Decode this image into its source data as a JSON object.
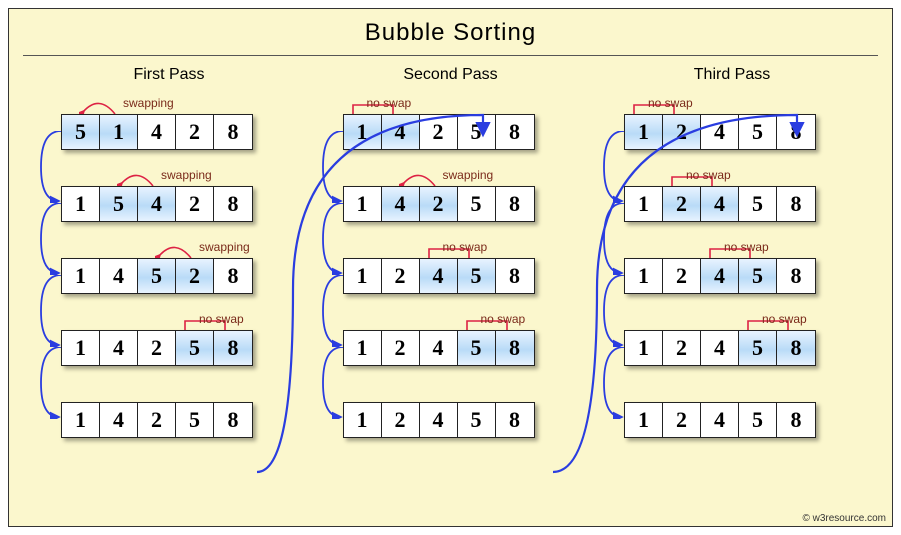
{
  "title": "Bubble  Sorting",
  "copyright": "© w3resource.com",
  "labels": {
    "swap": "swapping",
    "noswap": "no swap"
  },
  "passes": [
    {
      "name": "First  Pass",
      "steps": [
        {
          "cells": [
            5,
            1,
            4,
            2,
            8
          ],
          "hl": [
            0,
            1
          ],
          "action": "swap"
        },
        {
          "cells": [
            1,
            5,
            4,
            2,
            8
          ],
          "hl": [
            1,
            2
          ],
          "action": "swap"
        },
        {
          "cells": [
            1,
            4,
            5,
            2,
            8
          ],
          "hl": [
            2,
            3
          ],
          "action": "swap"
        },
        {
          "cells": [
            1,
            4,
            2,
            5,
            8
          ],
          "hl": [
            3,
            4
          ],
          "action": "noswap"
        },
        {
          "cells": [
            1,
            4,
            2,
            5,
            8
          ],
          "hl": [],
          "action": "none"
        }
      ]
    },
    {
      "name": "Second  Pass",
      "steps": [
        {
          "cells": [
            1,
            4,
            2,
            5,
            8
          ],
          "hl": [
            0,
            1
          ],
          "action": "noswap"
        },
        {
          "cells": [
            1,
            4,
            2,
            5,
            8
          ],
          "hl": [
            1,
            2
          ],
          "action": "swap"
        },
        {
          "cells": [
            1,
            2,
            4,
            5,
            8
          ],
          "hl": [
            2,
            3
          ],
          "action": "noswap"
        },
        {
          "cells": [
            1,
            2,
            4,
            5,
            8
          ],
          "hl": [
            3,
            4
          ],
          "action": "noswap"
        },
        {
          "cells": [
            1,
            2,
            4,
            5,
            8
          ],
          "hl": [],
          "action": "none"
        }
      ]
    },
    {
      "name": "Third  Pass",
      "steps": [
        {
          "cells": [
            1,
            2,
            4,
            5,
            8
          ],
          "hl": [
            0,
            1
          ],
          "action": "noswap"
        },
        {
          "cells": [
            1,
            2,
            4,
            5,
            8
          ],
          "hl": [
            1,
            2
          ],
          "action": "noswap"
        },
        {
          "cells": [
            1,
            2,
            4,
            5,
            8
          ],
          "hl": [
            2,
            3
          ],
          "action": "noswap"
        },
        {
          "cells": [
            1,
            2,
            4,
            5,
            8
          ],
          "hl": [
            3,
            4
          ],
          "action": "noswap"
        },
        {
          "cells": [
            1,
            2,
            4,
            5,
            8
          ],
          "hl": [],
          "action": "none"
        }
      ]
    }
  ]
}
